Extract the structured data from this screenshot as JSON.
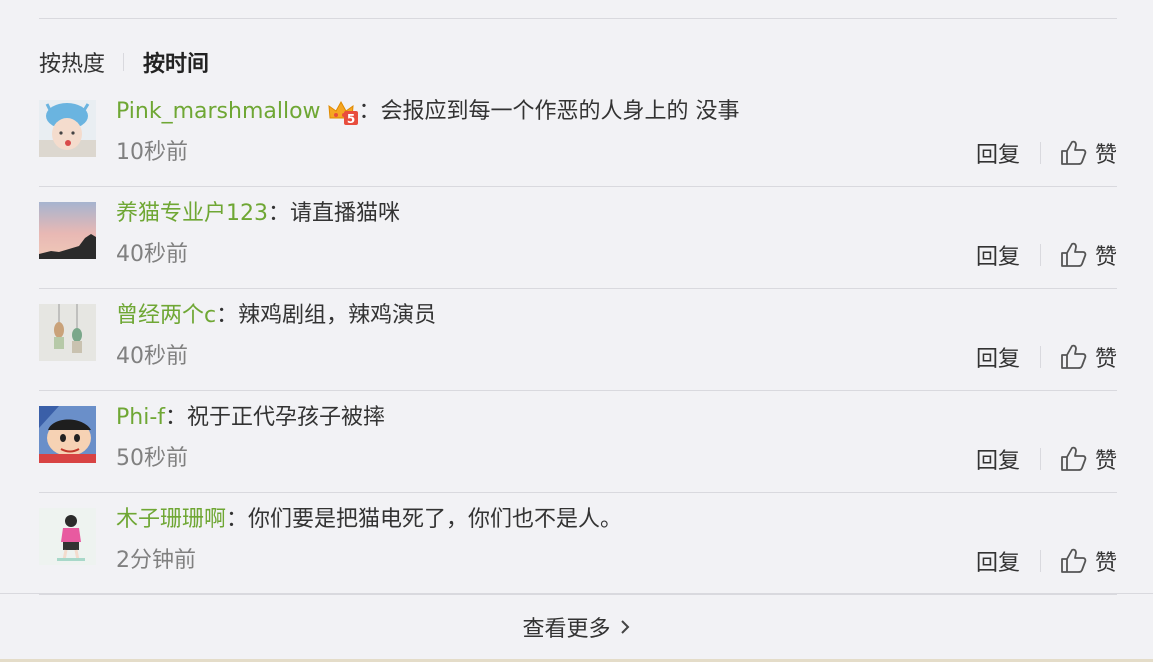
{
  "sort": {
    "hot_label": "按热度",
    "time_label": "按时间"
  },
  "actions": {
    "reply_label": "回复",
    "like_label": "赞"
  },
  "comments": [
    {
      "user": "Pink_marshmallow",
      "text": "会报应到每一个作恶的人身上的 没事",
      "time": "10秒前",
      "has_badge": true,
      "badge_number": "5"
    },
    {
      "user": "养猫专业户123",
      "text": "请直播猫咪",
      "time": "40秒前"
    },
    {
      "user": "曾经两个c",
      "text": "辣鸡剧组，辣鸡演员",
      "time": "40秒前"
    },
    {
      "user": "Phi-f",
      "text": "祝于正代孕孩子被摔",
      "time": "50秒前"
    },
    {
      "user": "木子珊珊啊",
      "text": "你们要是把猫电死了，你们也不是人。",
      "time": "2分钟前"
    }
  ],
  "colon": "：",
  "more": {
    "label": "查看更多"
  },
  "colors": {
    "username": "#6fa734",
    "text": "#333333",
    "time": "#808080",
    "divider": "#d9d9de",
    "background": "#f2f2f5"
  }
}
